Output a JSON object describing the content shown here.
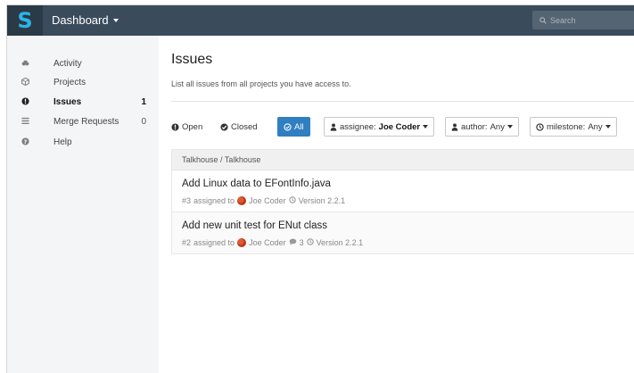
{
  "header": {
    "logo_glyph": "S",
    "brand": "Dashboard",
    "search_placeholder": "Search",
    "colors": {
      "bar": "#3a4b5c",
      "logo_bg": "#2b3a47",
      "logo": "#2ab6e8"
    }
  },
  "sidebar": {
    "items": [
      {
        "icon": "activity-icon",
        "label": "Activity",
        "count": ""
      },
      {
        "icon": "projects-icon",
        "label": "Projects",
        "count": ""
      },
      {
        "icon": "issues-icon",
        "label": "Issues",
        "count": "1",
        "active": true
      },
      {
        "icon": "merge-requests-icon",
        "label": "Merge Requests",
        "count": "0"
      },
      {
        "icon": "help-icon",
        "label": "Help",
        "count": ""
      }
    ]
  },
  "main": {
    "title": "Issues",
    "subtitle": "List all issues from all projects you have access to.",
    "filters": {
      "open": "Open",
      "closed": "Closed",
      "all": "All",
      "assignee_prefix": "assignee:",
      "assignee_value": "Joe Coder",
      "author_prefix": "author:",
      "author_value": "Any",
      "milestone_prefix": "milestone:",
      "milestone_value": "Any",
      "accent": "#2f7fc1"
    },
    "group": "Talkhouse / Talkhouse",
    "issues": [
      {
        "title": "Add Linux data to EFontInfo.java",
        "number": "#3",
        "assigned_text": "assigned to",
        "assignee": "Joe Coder",
        "comments": "",
        "milestone": "Version 2.2.1"
      },
      {
        "title": "Add new unit test for ENut class",
        "number": "#2",
        "assigned_text": "assigned to",
        "assignee": "Joe Coder",
        "comments": "3",
        "milestone": "Version 2.2.1"
      }
    ]
  }
}
